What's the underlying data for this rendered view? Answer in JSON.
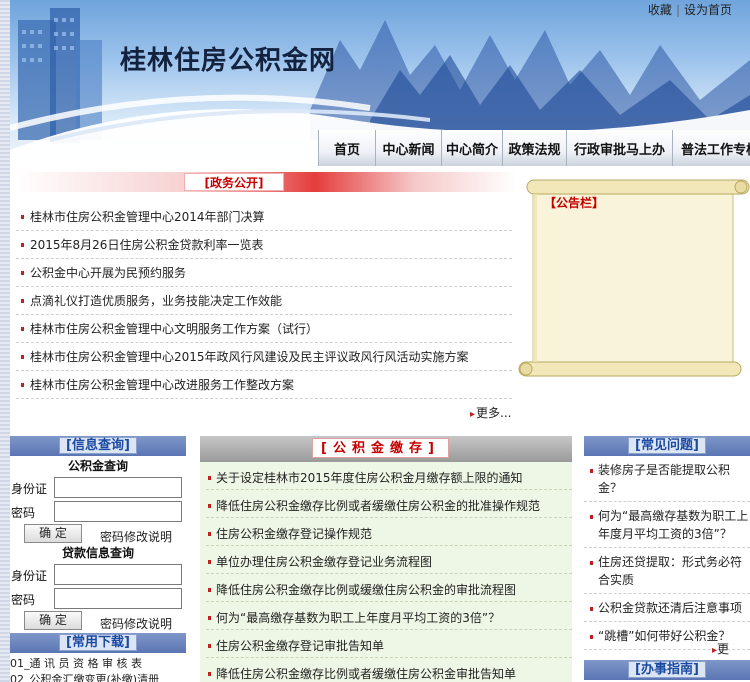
{
  "header": {
    "site_title": "桂林住房公积金网",
    "top_links": [
      "收藏",
      "设为首页"
    ]
  },
  "nav": {
    "tabs": [
      "首页",
      "中心新闻",
      "中心简介",
      "政策法规",
      "行政审批马上办",
      "普法工作专栏"
    ]
  },
  "gov_affairs": {
    "title": "[政务公开]",
    "items": [
      "桂林市住房公积金管理中心2014年部门决算",
      "2015年8月26日住房公积金贷款利率一览表",
      "公积金中心开展为民预约服务",
      "点滴礼仪打造优质服务，业务技能决定工作效能",
      "桂林市住房公积金管理中心文明服务工作方案（试行）",
      "桂林市住房公积金管理中心2015年政风行风建设及民主评议政风行风活动实施方案",
      "桂林市住房公积金管理中心改进服务工作整改方案"
    ],
    "more": "更多..."
  },
  "bulletin": {
    "title": "【公告栏】"
  },
  "info_query": {
    "header": "[信息查询]",
    "fund_query_title": "公积金查询",
    "loan_query_title": "贷款信息查询",
    "id_label": "身份证",
    "password_label": "密码",
    "confirm_button": "确 定",
    "change_password_link": "密码修改说明"
  },
  "downloads": {
    "header": "[常用下载]",
    "items": [
      "01_通 讯 员 资 格 审 核 表",
      "02_公积金汇缴变更(补缴)清册"
    ]
  },
  "fund_deposit": {
    "title": "[公积金缴存]",
    "items": [
      "关于设定桂林市2015年度住房公积金月缴存额上限的通知",
      "降低住房公积金缴存比例或者缓缴住房公积金的批准操作规范",
      "住房公积金缴存登记操作规范",
      "单位办理住房公积金缴存登记业务流程图",
      "降低住房公积金缴存比例或缓缴住房公积金的审批流程图",
      "何为“最高缴存基数为职工上年度月平均工资的3倍”？",
      "住房公积金缴存登记审批告知单",
      "降低住房公积金缴存比例或者缓缴住房公积金审批告知单"
    ]
  },
  "faq": {
    "header": "[常见问题]",
    "items": [
      "装修房子是否能提取公积金？",
      "何为“最高缴存基数为职工上年度月平均工资的3倍”？",
      "住房还贷提取：形式务必符合实质",
      "公积金贷款还清后注意事项",
      "“跳槽”如何带好公积金？"
    ],
    "more": "更多..."
  },
  "guide": {
    "header": "[办事指南]"
  }
}
